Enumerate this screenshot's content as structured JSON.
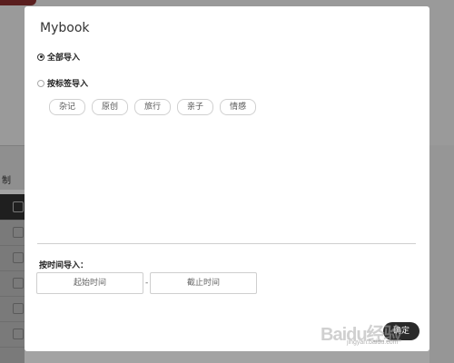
{
  "background": {
    "tab_text": "制"
  },
  "modal": {
    "title": "Mybook",
    "options": [
      {
        "label": "全部导入",
        "checked": true
      },
      {
        "label": "按标签导入",
        "checked": false
      }
    ],
    "tags": [
      "杂记",
      "原创",
      "旅行",
      "亲子",
      "情感"
    ],
    "time_section": {
      "label": "按时间导入：",
      "start_placeholder": "起始时间",
      "separator": "-",
      "end_placeholder": "截止时间"
    },
    "confirm_label": "确定"
  },
  "watermark": {
    "text": "Baidu经验",
    "sub": "jingyan.baidu.com"
  }
}
